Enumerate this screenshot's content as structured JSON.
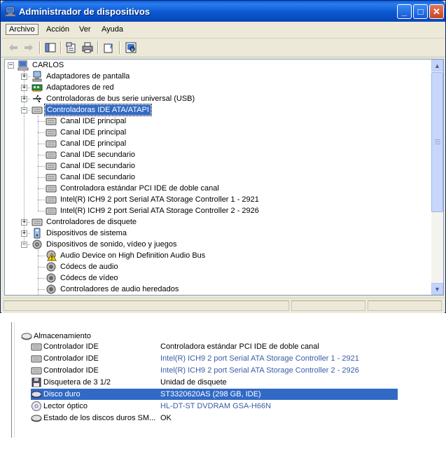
{
  "window": {
    "title": "Administrador de dispositivos",
    "min_symbol": "_",
    "max_symbol": "□",
    "close_symbol": "✕"
  },
  "menu": [
    "Archivo",
    "Acción",
    "Ver",
    "Ayuda"
  ],
  "toolbar_icons": [
    "back-arrow-icon",
    "forward-arrow-icon",
    "show-hide-tree-icon",
    "properties-icon",
    "print-icon",
    "help-icon",
    "scan-hardware-icon"
  ],
  "tree": {
    "root": "CARLOS",
    "items": [
      {
        "label": "Adaptadores de pantalla",
        "icon": "display-adapter-icon"
      },
      {
        "label": "Adaptadores de red",
        "icon": "network-adapter-icon"
      },
      {
        "label": "Controladoras de bus serie universal (USB)",
        "icon": "usb-icon"
      },
      {
        "label": "Controladoras IDE ATA/ATAPI",
        "icon": "ide-controller-icon",
        "expanded": true,
        "selected": true,
        "children": [
          "Canal IDE principal",
          "Canal IDE principal",
          "Canal IDE principal",
          "Canal IDE secundario",
          "Canal IDE secundario",
          "Canal IDE secundario",
          "Controladora estándar PCI IDE de doble canal",
          "Intel(R) ICH9 2 port Serial ATA Storage Controller 1 - 2921",
          "Intel(R) ICH9 2 port Serial ATA Storage Controller 2 - 2926"
        ]
      },
      {
        "label": "Controladores de disquete",
        "icon": "floppy-controller-icon"
      },
      {
        "label": "Dispositivos de sistema",
        "icon": "system-device-icon"
      },
      {
        "label": "Dispositivos de sonido, vídeo y juegos",
        "icon": "sound-device-icon",
        "expanded": true,
        "children": [
          "Audio Device on High Definition Audio Bus",
          "Códecs de audio",
          "Códecs de vídeo",
          "Controladores de audio heredados"
        ]
      }
    ]
  },
  "storage": {
    "header": "Almacenamiento",
    "rows": [
      {
        "name": "Controlador IDE",
        "value": "Controladora estándar PCI IDE de doble canal",
        "blue": false,
        "icon": "ide-controller-icon"
      },
      {
        "name": "Controlador IDE",
        "value": "Intel(R) ICH9 2 port Serial ATA Storage Controller 1 - 2921",
        "blue": true,
        "icon": "ide-controller-icon"
      },
      {
        "name": "Controlador IDE",
        "value": "Intel(R) ICH9 2 port Serial ATA Storage Controller 2 - 2926",
        "blue": true,
        "icon": "ide-controller-icon"
      },
      {
        "name": "Disquetera de 3 1/2",
        "value": "Unidad de disquete",
        "blue": false,
        "icon": "floppy-drive-icon"
      },
      {
        "name": "Disco duro",
        "value": "ST3320620AS  (298 GB, IDE)",
        "blue": false,
        "selected": true,
        "icon": "hard-disk-icon"
      },
      {
        "name": "Lector óptico",
        "value": "HL-DT-ST DVDRAM GSA-H66N",
        "blue": true,
        "icon": "optical-drive-icon"
      },
      {
        "name": "Estado de los discos duros SM...",
        "value": "OK",
        "blue": false,
        "icon": "disk-status-icon"
      }
    ]
  },
  "colors": {
    "titlebar": "#0a58d0",
    "selection": "#316ac5",
    "link_blue": "#3a5ca8",
    "window_bg": "#ece9d8"
  }
}
